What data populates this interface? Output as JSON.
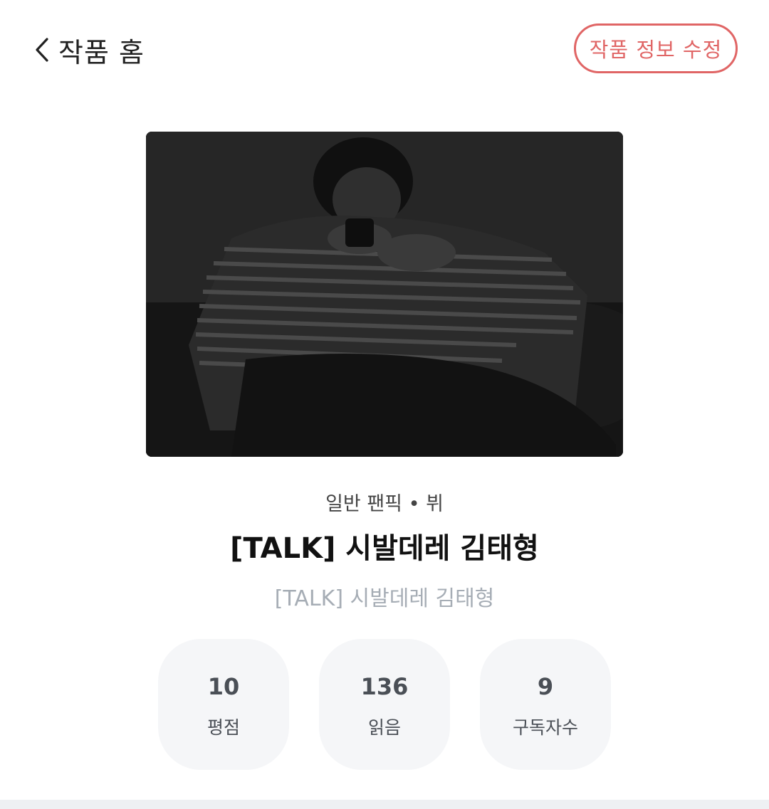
{
  "header": {
    "back_icon": "chevron-left-icon",
    "title": "작품 홈",
    "edit_label": "작품 정보 수정",
    "accent_color": "#e06565"
  },
  "work": {
    "cover_description": "grayscale-photo",
    "category": "일반 팬픽 • 뷔",
    "title": "[TALK] 시발데레 김태형",
    "subtitle": "[TALK] 시발데레 김태형"
  },
  "stats": [
    {
      "value": "10",
      "label": "평점"
    },
    {
      "value": "136",
      "label": "읽음"
    },
    {
      "value": "9",
      "label": "구독자수"
    }
  ]
}
